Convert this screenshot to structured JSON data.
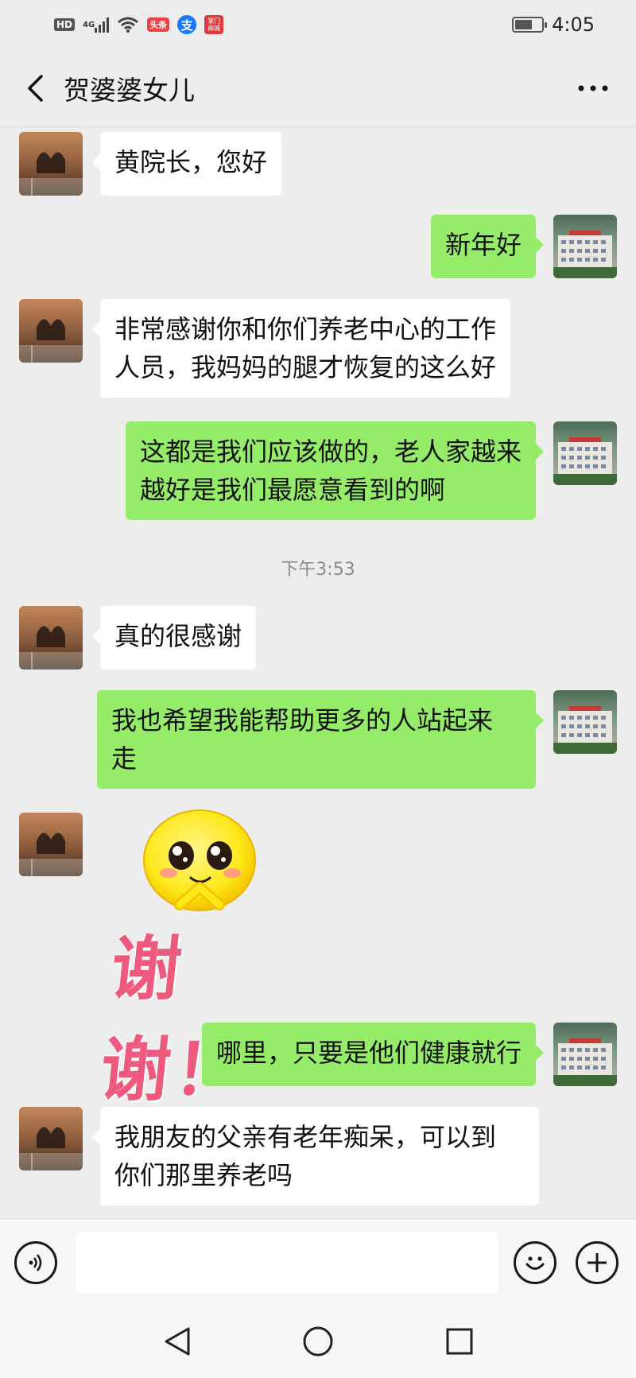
{
  "status_bar": {
    "hd": "HD",
    "network": "4G",
    "toutiao": "头条",
    "alipay": "支",
    "app": "掌门 商城",
    "time": "4:05",
    "battery_level": 0.65
  },
  "header": {
    "title": "贺婆婆女儿",
    "back_icon": "chevron-left-icon",
    "more_icon": "more-dots-icon"
  },
  "messages": [
    {
      "from": "contact",
      "text": "黄院长，您好"
    },
    {
      "from": "me",
      "text": "新年好"
    },
    {
      "from": "contact",
      "lines": [
        "非常感谢你和你们养老中心的工作",
        "人员，我妈妈的腿才恢复的这么好"
      ]
    },
    {
      "from": "me",
      "lines": [
        "这都是我们应该做的，老人家越来",
        "越好是我们最愿意看到的啊"
      ]
    },
    {
      "type": "timestamp",
      "text": "下午3:53"
    },
    {
      "from": "contact",
      "text": "真的很感谢"
    },
    {
      "from": "me",
      "lines": [
        "我也希望我能帮助更多的人站起来",
        "走"
      ]
    },
    {
      "from": "contact",
      "type": "sticker",
      "sticker_text": "谢谢！",
      "sticker_icon": "smiley-thanks-sticker"
    },
    {
      "from": "me",
      "text": "哪里，只要是他们健康就行"
    },
    {
      "from": "contact",
      "lines": [
        "我朋友的父亲有老年痴呆，可以到",
        "你们那里养老吗"
      ]
    }
  ],
  "input_bar": {
    "voice_icon": "voice-icon",
    "emoji_icon": "emoji-icon",
    "plus_icon": "plus-icon",
    "input_value": ""
  },
  "nav_bar": {
    "back_icon": "nav-back-icon",
    "home_icon": "nav-home-icon",
    "recents_icon": "nav-recents-icon"
  },
  "colors": {
    "background": "#ededed",
    "outgoing_bubble": "#95ec69",
    "incoming_bubble": "#ffffff",
    "sticker_text": "#ee5a7e"
  }
}
